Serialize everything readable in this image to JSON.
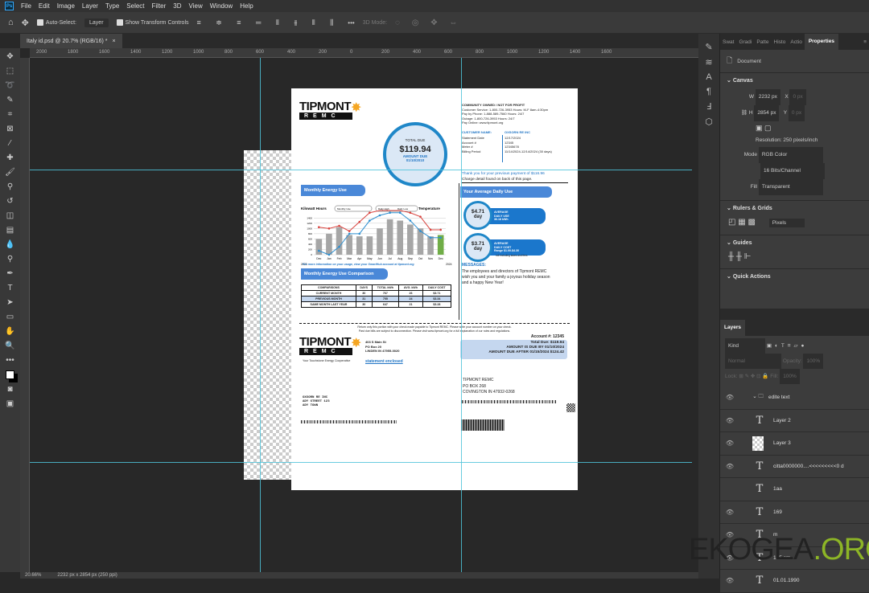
{
  "app": {
    "logo": "Ps",
    "menu": [
      "File",
      "Edit",
      "Image",
      "Layer",
      "Type",
      "Select",
      "Filter",
      "3D",
      "View",
      "Window",
      "Help"
    ]
  },
  "options": {
    "auto_select_label": "Auto-Select:",
    "auto_select_value": "Layer",
    "show_transform_label": "Show Transform Controls",
    "three_d_mode": "3D Mode:",
    "more": "•••"
  },
  "tab": {
    "title": "Italy id.psd @ 20.7% (RGB/16) *",
    "close": "×"
  },
  "ruler": {
    "ticks": [
      "2000",
      "1800",
      "1600",
      "1400",
      "1200",
      "1000",
      "800",
      "600",
      "400",
      "200",
      "0",
      "200",
      "400",
      "600",
      "800",
      "1000",
      "1200",
      "1400",
      "1600"
    ]
  },
  "status": {
    "zoom": "20.66%",
    "size": "2232 px x 2854 px (250 ppi)"
  },
  "properties": {
    "tabs": [
      "Swat",
      "Gradi",
      "Patte",
      "Histo",
      "Actio",
      "Properties"
    ],
    "document_label": "Document",
    "canvas_header": "Canvas",
    "w_label": "W",
    "w_value": "2232 px",
    "h_label": "H",
    "h_value": "2854 px",
    "x_label": "X",
    "x_value": "0 px",
    "y_label": "Y",
    "y_value": "0 px",
    "resolution": "Resolution: 250 pixels/inch",
    "mode_label": "Mode",
    "mode_value": "RGB Color",
    "depth_value": "16 Bits/Channel",
    "fill_label": "Fill",
    "fill_value": "Transparent",
    "rulers_header": "Rulers & Grids",
    "units_value": "Pixels",
    "guides_header": "Guides",
    "quick_actions_header": "Quick Actions"
  },
  "layers": {
    "tab": "Layers",
    "kind": "Kind",
    "blend": "Normal",
    "opacity_label": "Opacity:",
    "opacity_value": "100%",
    "lock_label": "Lock:",
    "fill_label": "Fill:",
    "fill_value": "100%",
    "items": [
      {
        "name": "edite text",
        "type": "group"
      },
      {
        "name": "Layer 2",
        "type": "text"
      },
      {
        "name": "Layer 3",
        "type": "image"
      },
      {
        "name": "citta0000000....<<<<<<<<<0 d",
        "type": "text"
      },
      {
        "name": "1aa",
        "type": "text"
      },
      {
        "name": "169",
        "type": "text"
      },
      {
        "name": "m",
        "type": "text"
      },
      {
        "name": "125 cm",
        "type": "text"
      },
      {
        "name": "01.01.1990",
        "type": "text"
      }
    ]
  },
  "watermark": {
    "part1": "EKOGEA",
    "part2": ".ORG"
  },
  "document": {
    "logo_top": "TIPMONT",
    "logo_bottom": "REMC",
    "header_lines": [
      "COMMUNITY OWNED / NOT FOR PROFIT",
      "Customer Service: 1-800-726-3953 Hours: M-F 8am-4:30pm",
      "Pay by Phone: 1-888-589-7560 Hours: 24/7",
      "Outage: 1-800-726-3953 Hours: 24/7",
      "Pay Online: www.tipmont.org"
    ],
    "customer_name_label": "CUSTOMER NAME:",
    "customer_name": "OXSORN RE INC",
    "info": [
      [
        "Statement Date",
        "12/17/2024"
      ],
      [
        "Account #",
        "12345"
      ],
      [
        "Meter #",
        "12345678"
      ],
      [
        "Billing Period",
        "11/14/2024-12/14/2024 (30 days)"
      ]
    ],
    "total_due_label": "TOTAL DUE",
    "total_due": "$119.94",
    "amount_due_label": "AMOUNT DUE",
    "amount_due_date": "01/10/2010",
    "thanks": "Thank you for your previous payment of $116.96",
    "charge_detail": "Charge detail found on back of this page.",
    "monthly_use_title": "Monthly Energy Use",
    "avg_daily_title": "Your Average Daily Use",
    "avg_use_value": "$4.71",
    "avg_use_unit": "day",
    "avg_use_lines": [
      "AVERAGE",
      "DAILY USE",
      "36.18 kWh"
    ],
    "avg_cost_value": "$3.71",
    "avg_cost_unit": "day",
    "avg_cost_lines": [
      "AVERAGE",
      "DAILY COST",
      "Range $1.00-$4.30",
      "not including taxes and fees"
    ],
    "messages_label": "MESSAGES:",
    "message": "The employees and directors of Tipmont REMC wish you and your family a joyous holiday season and a happy New Year!",
    "more_info": "For more information on your usage, view your SmartHub account at tipmont.org",
    "comparison_title": "Monthly Energy Use Comparison",
    "comparison_headers": [
      "COMPARISONS",
      "DAYS",
      "TOTAL kWh",
      "AVG. kWh",
      "DAILY COST"
    ],
    "comparison_rows": [
      [
        "CURRENT MONTH",
        "30",
        "767",
        "26",
        "$3.71"
      ],
      [
        "PREVIOUS MONTH",
        "31",
        "755",
        "24",
        "$3.34"
      ],
      [
        "SAME MONTH LAST YEAR",
        "30",
        "647",
        "21",
        "$3.28"
      ]
    ],
    "stub_notice_1": "Return only this portion with your check made payable to Tipmont REMC. Please write your account number on your check.",
    "stub_notice_2": "Past due bills are subject to disconnection. Please visit www.tipmont.org for a full explanation of our rules and regulations.",
    "coop_tagline": "Your Touchstone Energy Cooperative",
    "sender_address": [
      "403 S Main St",
      "PO Box 20",
      "LINDEN IN 47955-0020"
    ],
    "statement_enclosed": "statement enclosed",
    "stub_account": "Account #: 12345",
    "stub_total": "Total Due: $119.94",
    "stub_due_by": "AMOUNT IS DUE BY 01/10/2024",
    "stub_due_after": "AMOUNT DUE AFTER 01/15/2024 $124.42",
    "remit_address": [
      "TIPMONT REMC",
      "PO BOX 268",
      "COVINGTON IN 47932-0268"
    ],
    "recipient_address": [
      "OXSORN RE INC",
      "ADY STREET 123",
      "ADY TOWN"
    ]
  },
  "chart_data": {
    "type": "bar",
    "title": "Monthly Energy Use",
    "ylabel": "Kilowatt Hours",
    "y2label": "Temperature",
    "legend": [
      "Monthly Use",
      "Daily High",
      "Daily Low"
    ],
    "categories": [
      "Dec",
      "Jan",
      "Feb",
      "Mar",
      "Apr",
      "May",
      "Jun",
      "Jul",
      "Aug",
      "Sep",
      "Oct",
      "Nov",
      "Dec"
    ],
    "start_year": "2023",
    "end_year": "2024",
    "yticks": [
      "0",
      "200",
      "400",
      "600",
      "800",
      "1000",
      "1200",
      "1400"
    ],
    "ylim": [
      0,
      1500
    ],
    "series": [
      {
        "name": "Monthly Use",
        "values": [
          600,
          800,
          1050,
          750,
          700,
          700,
          1000,
          1350,
          1300,
          1150,
          1000,
          700,
          750
        ]
      },
      {
        "name": "Daily High",
        "values": [
          1050,
          1000,
          1100,
          900,
          1250,
          1600,
          1700,
          1700,
          1700,
          1600,
          1450,
          950,
          950
        ]
      },
      {
        "name": "Daily Low",
        "values": [
          150,
          0,
          300,
          800,
          800,
          1300,
          1500,
          1600,
          1600,
          1300,
          900,
          650,
          650
        ]
      }
    ],
    "colors": {
      "bar": "#a6a6a6",
      "last_bar": "#70ad47",
      "high": "#d9443f",
      "low": "#2e8fd0"
    }
  }
}
